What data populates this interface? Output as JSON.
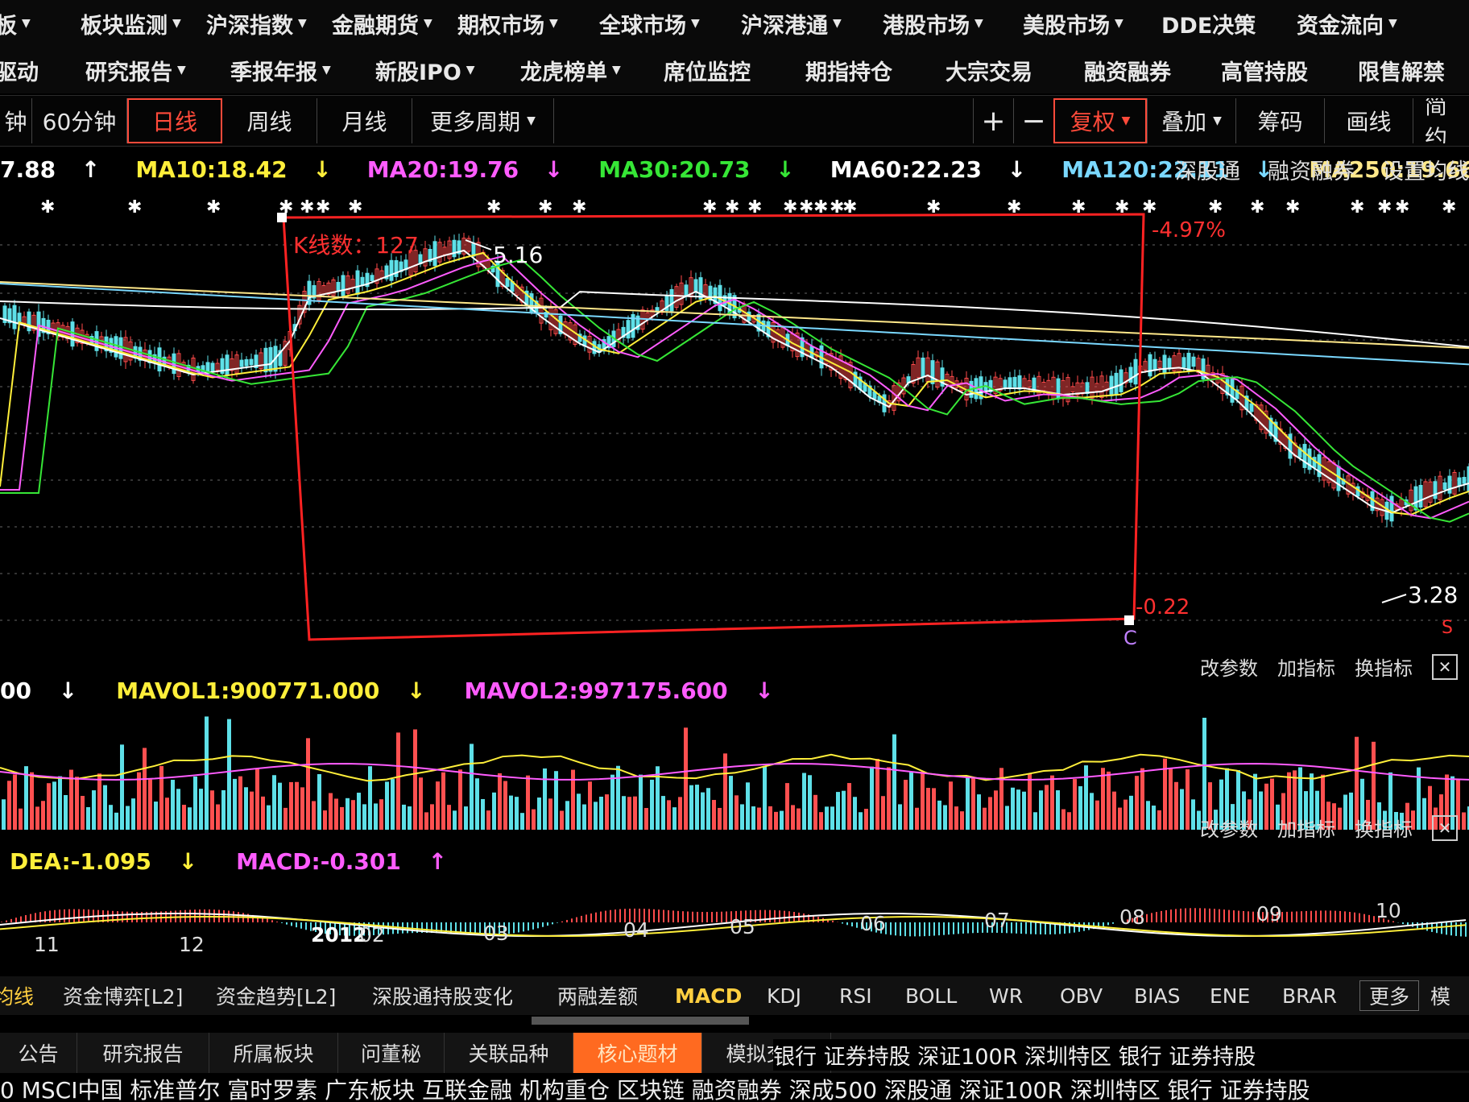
{
  "nav_row1": [
    "板",
    "板块监测",
    "沪深指数",
    "金融期货",
    "期权市场",
    "全球市场",
    "沪深港通",
    "港股市场",
    "美股市场",
    "DDE决策",
    "资金流向"
  ],
  "nav_row2": [
    "驱动",
    "研究报告",
    "季报年报",
    "新股IPO",
    "龙虎榜单",
    "席位监控",
    "期指持仓",
    "大宗交易",
    "融资融券",
    "高管持股",
    "限售解禁"
  ],
  "periods": {
    "min": "钟",
    "m60": "60分钟",
    "day": "日线",
    "week": "周线",
    "month": "月线",
    "more": "更多周期"
  },
  "tools": {
    "plus": "+",
    "minus": "−",
    "fuquan": "复权",
    "overlay": "叠加",
    "chips": "筹码",
    "draw": "画线",
    "simple": "简约"
  },
  "ma": {
    "ma5": "7.88",
    "ma10": "MA10:18.42",
    "ma20": "MA20:19.76",
    "ma30": "MA30:20.73",
    "ma60": "MA60:22.23",
    "ma120": "MA120:22.11",
    "ma250": "MA250:19.66"
  },
  "links": [
    "深股通",
    "融资融券",
    "设置均线"
  ],
  "chart": {
    "kline_count": "K线数：127",
    "high_label": "5.16",
    "low_label": "3.28",
    "pct_top": "-4.97%",
    "pct_bottom": "-0.22",
    "marker_c": "C",
    "marker_s": "S"
  },
  "vol_tools": [
    "改参数",
    "加指标",
    "换指标"
  ],
  "vol": {
    "v0": "00",
    "mavol1": "MAVOL1:900771.000",
    "mavol2": "MAVOL2:997175.600"
  },
  "macd_tools": [
    "改参数",
    "加指标",
    "换指标"
  ],
  "macd": {
    "dea": "DEA:-1.095",
    "macd": "MACD:-0.301"
  },
  "months": [
    "11",
    "12",
    "2012",
    "02",
    "03",
    "04",
    "05",
    "06",
    "07",
    "08",
    "09",
    "10"
  ],
  "indicator_tabs": [
    "均线",
    "资金博弈[L2]",
    "资金趋势[L2]",
    "深股通持股变化",
    "两融差额",
    "MACD",
    "KDJ",
    "RSI",
    "BOLL",
    "WR",
    "OBV",
    "BIAS",
    "ENE",
    "BRAR",
    "更多",
    "模"
  ],
  "bottom_tabs": [
    "公告",
    "研究报告",
    "所属板块",
    "问董秘",
    "关联品种",
    "核心题材",
    "模拟交易"
  ],
  "tags_line1": "银行 证券持股 深证100R 深圳特区 银行 证券持股",
  "tags_line": "0   MSCI中国 标准普尔 富时罗素 广东板块 互联金融 机构重仓 区块链 融资融券 深成500 深股通 深证100R 深圳特区 银行 证券持股"
}
